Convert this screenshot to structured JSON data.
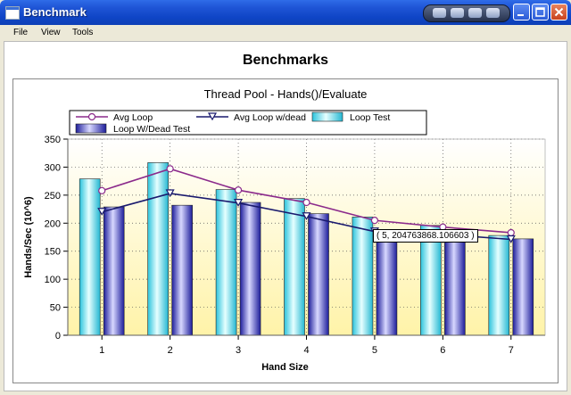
{
  "window": {
    "title": "Benchmark"
  },
  "menu": [
    "File",
    "View",
    "Tools"
  ],
  "page_title": "Benchmarks",
  "tooltip": "( 5, 204763868.106603 )",
  "chart_data": {
    "type": "bar",
    "title": "Thread Pool - Hands()/Evaluate",
    "xlabel": "Hand Size",
    "ylabel": "Hands/Sec (10^6)",
    "categories": [
      "1",
      "2",
      "3",
      "4",
      "5",
      "6",
      "7"
    ],
    "ylim": [
      0,
      350
    ],
    "yticks": [
      0,
      50,
      100,
      150,
      200,
      250,
      300,
      350
    ],
    "grid": true,
    "legend_position": "top",
    "series": [
      {
        "name": "Avg Loop",
        "type": "line",
        "marker": "circle",
        "color": "#8b2a8b",
        "values": [
          258,
          297,
          259,
          237,
          205,
          193,
          183
        ]
      },
      {
        "name": "Avg Loop w/dead",
        "type": "line",
        "marker": "triangle-down",
        "color": "#1a1a6e",
        "values": [
          220,
          253,
          236,
          212,
          185,
          180,
          171
        ]
      },
      {
        "name": "Loop Test",
        "type": "bar",
        "color": "#39d8ee",
        "values": [
          279,
          308,
          260,
          244,
          211,
          196,
          178
        ]
      },
      {
        "name": "Loop W/Dead Test",
        "type": "bar",
        "color": "#2f2fb8",
        "values": [
          229,
          232,
          237,
          217,
          175,
          172,
          172
        ]
      }
    ]
  }
}
